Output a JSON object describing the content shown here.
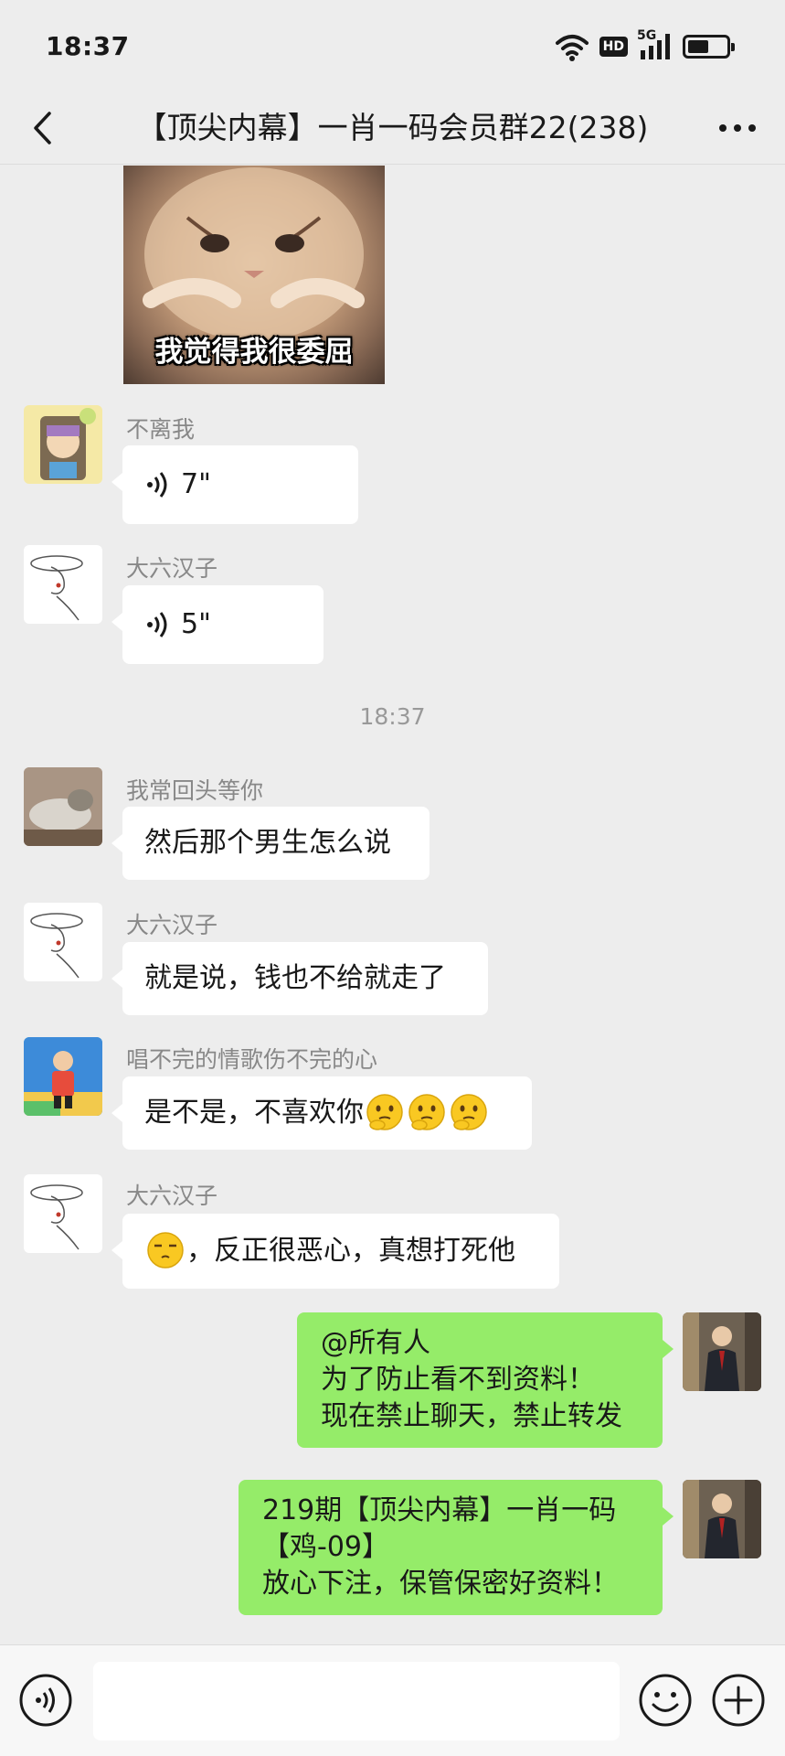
{
  "status_bar": {
    "time": "18:37",
    "hd_label": "HD",
    "network_label": "5G",
    "battery_level": 0.55
  },
  "header": {
    "title": "【顶尖内幕】一肖一码会员群22(238)"
  },
  "sticker": {
    "caption": "我觉得我很委屈"
  },
  "messages": [
    {
      "sender": "不离我",
      "type": "voice",
      "duration": "7\""
    },
    {
      "sender": "大六汉子",
      "type": "voice",
      "duration": "5\""
    },
    {
      "type": "time",
      "text": "18:37"
    },
    {
      "sender": "我常回头等你",
      "type": "text",
      "text": "然后那个男生怎么说"
    },
    {
      "sender": "大六汉子",
      "type": "text",
      "text": "就是说，钱也不给就走了"
    },
    {
      "sender": "唱不完的情歌伤不完的心",
      "type": "text",
      "text": "是不是，不喜欢你"
    },
    {
      "sender": "大六汉子",
      "type": "text",
      "text": "，反正很恶心，真想打死他"
    },
    {
      "type": "self",
      "lines": [
        "@所有人",
        "为了防止看不到资料！",
        "现在禁止聊天，禁止转发"
      ]
    },
    {
      "type": "self",
      "lines": [
        "219期【顶尖内幕】一肖一码",
        "【鸡-09】",
        "放心下注，保管保密好资料！"
      ]
    }
  ],
  "input_bar": {
    "placeholder": ""
  },
  "icons": {
    "back": "chevron-left-icon",
    "more": "more-dots-icon",
    "voice": "voice-icon",
    "emoji": "emoji-icon",
    "plus": "plus-icon"
  },
  "colors": {
    "background": "#ededed",
    "self_bubble": "#95ec69",
    "other_bubble": "#ffffff",
    "name_text": "#888888"
  }
}
